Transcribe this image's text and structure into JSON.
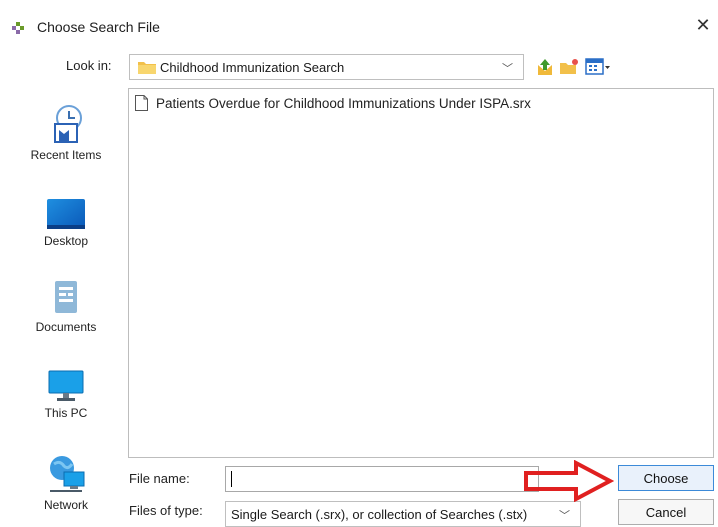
{
  "window": {
    "title": "Choose Search File",
    "close_glyph": "✕"
  },
  "lookin": {
    "label": "Look in:",
    "value": "Childhood Immunization Search"
  },
  "toolbar": {
    "up_icon": "up-folder-icon",
    "new_folder_icon": "new-folder-icon",
    "view_icon": "view-menu-icon"
  },
  "places": [
    {
      "label": "Recent Items",
      "icon": "recent-items-icon"
    },
    {
      "label": "Desktop",
      "icon": "desktop-icon"
    },
    {
      "label": "Documents",
      "icon": "documents-icon"
    },
    {
      "label": "This PC",
      "icon": "this-pc-icon"
    },
    {
      "label": "Network",
      "icon": "network-icon"
    }
  ],
  "files": [
    {
      "name": "Patients Overdue for Childhood Immunizations Under ISPA.srx"
    }
  ],
  "file_name": {
    "label": "File name:",
    "value": ""
  },
  "file_type": {
    "label": "Files of type:",
    "value": "Single Search (.srx), or collection of Searches (.stx)"
  },
  "buttons": {
    "choose": "Choose",
    "cancel": "Cancel"
  },
  "annotation": {
    "color": "#e02020"
  }
}
